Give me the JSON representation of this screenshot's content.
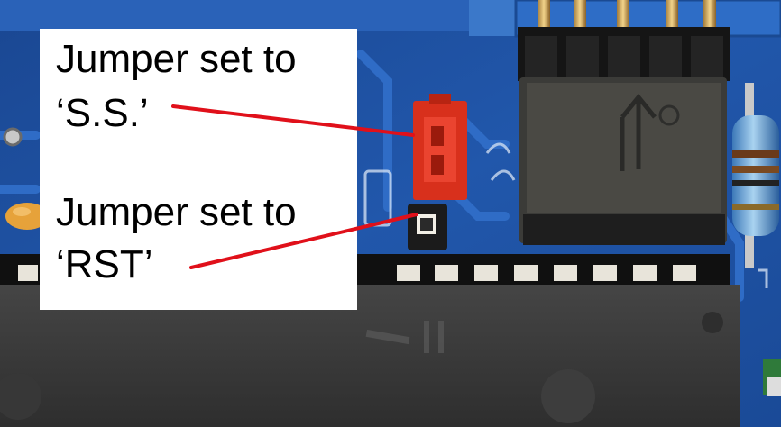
{
  "colors": {
    "board_blue": "#1d4e9e",
    "trace_blue": "#2d64b8",
    "callout_line": "#e0101a",
    "jumper_red": "#e8321e",
    "chip_body": "#3a3a3a",
    "header_black": "#151515"
  },
  "callouts": [
    {
      "line1": "Jumper set to",
      "line2": "‘S.S.’"
    },
    {
      "line1": "Jumper set to",
      "line2": "‘RST’"
    }
  ]
}
